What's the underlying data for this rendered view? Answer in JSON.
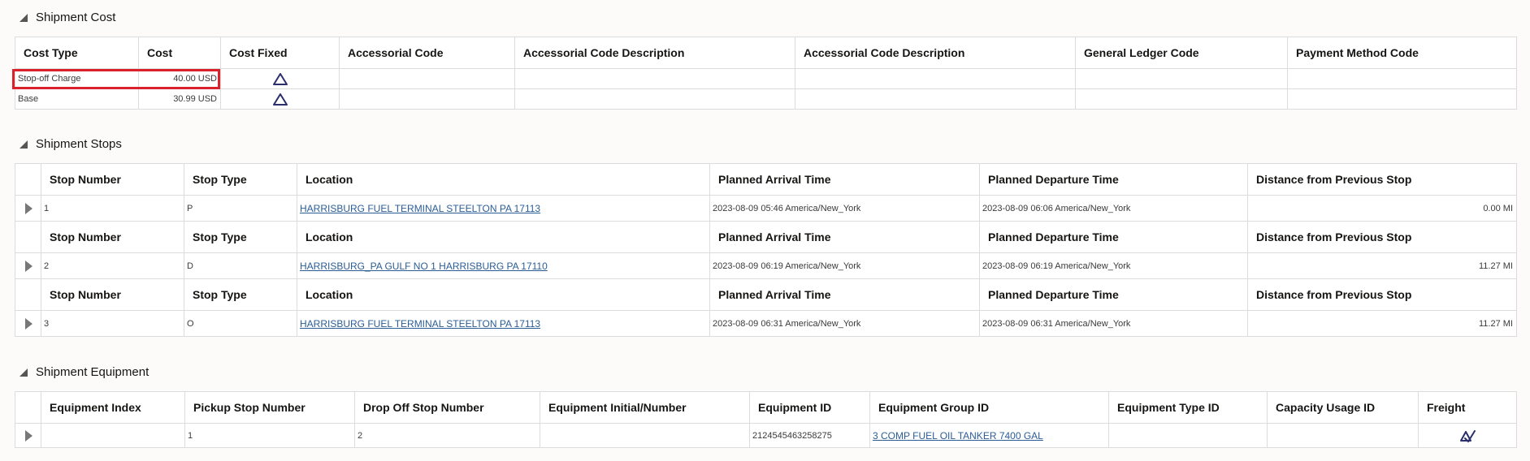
{
  "cost": {
    "title": "Shipment Cost",
    "headers": [
      "Cost Type",
      "Cost",
      "Cost Fixed",
      "Accessorial Code",
      "Accessorial Code Description",
      "Accessorial Code Description",
      "General Ledger Code",
      "Payment Method Code"
    ],
    "rows": [
      {
        "cost_type": "Stop-off Charge",
        "cost": "40.00 USD",
        "cost_fixed_icon": "triangle-outline-icon"
      },
      {
        "cost_type": "Base",
        "cost": "30.99 USD",
        "cost_fixed_icon": "triangle-outline-icon"
      }
    ]
  },
  "stops": {
    "title": "Shipment Stops",
    "headers": [
      "Stop Number",
      "Stop Type",
      "Location",
      "Planned Arrival Time",
      "Planned Departure Time",
      "Distance from Previous Stop"
    ],
    "rows": [
      {
        "stop_number": "1",
        "stop_type": "P",
        "location": "HARRISBURG FUEL TERMINAL STEELTON PA 17113",
        "arrival": "2023-08-09 05:46 America/New_York",
        "departure": "2023-08-09 06:06 America/New_York",
        "distance": "0.00 MI"
      },
      {
        "stop_number": "2",
        "stop_type": "D",
        "location": "HARRISBURG_PA GULF NO 1 HARRISBURG PA 17110",
        "arrival": "2023-08-09 06:19 America/New_York",
        "departure": "2023-08-09 06:19 America/New_York",
        "distance": "11.27 MI"
      },
      {
        "stop_number": "3",
        "stop_type": "O",
        "location": "HARRISBURG FUEL TERMINAL STEELTON PA 17113",
        "arrival": "2023-08-09 06:31 America/New_York",
        "departure": "2023-08-09 06:31 America/New_York",
        "distance": "11.27 MI"
      }
    ]
  },
  "equipment": {
    "title": "Shipment Equipment",
    "headers": [
      "Equipment Index",
      "Pickup Stop Number",
      "Drop Off Stop Number",
      "Equipment Initial/Number",
      "Equipment ID",
      "Equipment Group ID",
      "Equipment Type ID",
      "Capacity Usage ID",
      "Freight"
    ],
    "rows": [
      {
        "index": "",
        "pickup": "1",
        "dropoff": "2",
        "initial": "",
        "equipment_id": "2124545463258275",
        "group_id": "3 COMP FUEL OIL TANKER 7400 GAL",
        "type_id": "",
        "capacity": "",
        "freight_icon": "freight-check-icon"
      }
    ]
  },
  "colors": {
    "highlight": "#d9222b",
    "link": "#2a5d96",
    "icon": "#2b2f6b"
  }
}
